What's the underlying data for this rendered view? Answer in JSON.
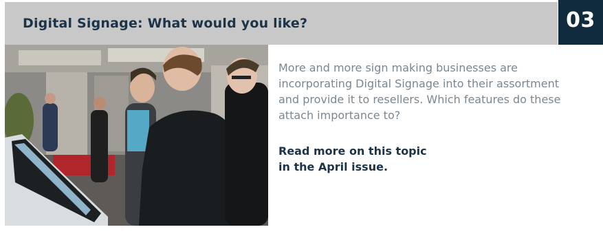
{
  "header": {
    "title": "Digital Signage: What would you like?",
    "issue_number": "03"
  },
  "article": {
    "photo_alt": "Visitors at a trade fair trying out a digital signage touchscreen kiosk",
    "body": "More and more sign making businesses are incorporating Digital Signage into their assortment and provide it to resellers. Which features do these attach importance to?",
    "read_more_line1": "Read more on this topic",
    "read_more_line2": "in the April issue."
  },
  "colors": {
    "header_bg": "#c8c8c8",
    "title_color": "#1c3449",
    "badge_bg": "#0f2b3d",
    "body_text": "#7a8791"
  }
}
